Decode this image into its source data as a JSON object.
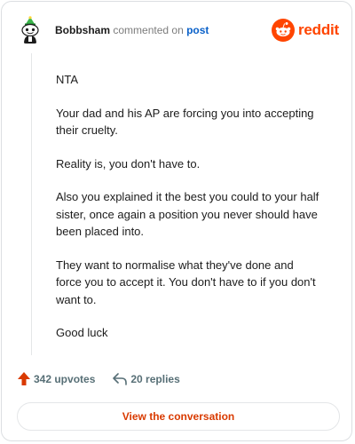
{
  "header": {
    "username": "Bobbsham",
    "action_text": "commented on",
    "post_link": "post",
    "brand": "reddit"
  },
  "comment": {
    "paragraphs": [
      "NTA",
      "Your dad and his AP are forcing you into accepting their cruelty.",
      "Reality is, you don't have to.",
      "Also you explained it the best you could to your half sister, once again a position you never should have been placed into.",
      "They want to normalise what they've done and force you to accept it. You don't have to if you don't want to.",
      "Good luck"
    ]
  },
  "footer": {
    "upvotes": "342 upvotes",
    "replies": "20 replies",
    "view_button": "View the conversation"
  },
  "icons": {
    "avatar": "snoo-avatar-icon",
    "logo": "reddit-snoo-icon",
    "upvote": "upvote-arrow-icon",
    "reply": "reply-arrow-icon"
  },
  "colors": {
    "brand": "#ff4500",
    "upvote_arrow": "#d93a00",
    "link": "#0a61c9",
    "muted": "#576f76",
    "button_text": "#d93a00"
  }
}
